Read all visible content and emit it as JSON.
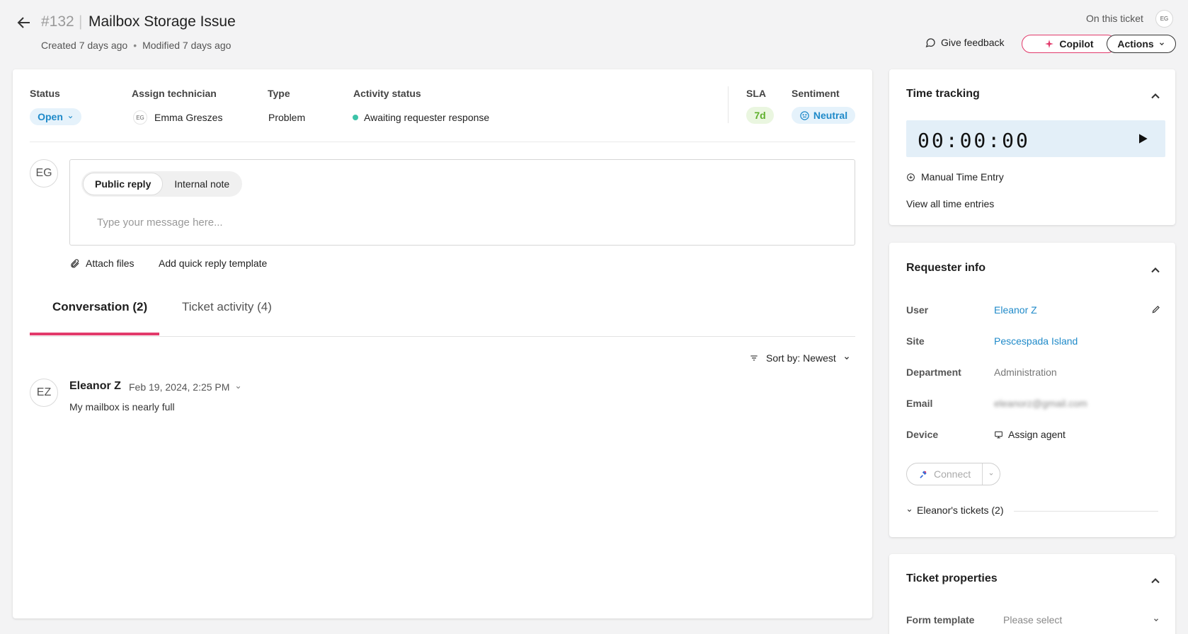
{
  "header": {
    "ticket_number": "#132",
    "separator": "|",
    "title": "Mailbox Storage Issue",
    "created": "Created 7 days ago",
    "meta_dot": "•",
    "modified": "Modified 7 days ago",
    "on_this_ticket": "On this ticket",
    "viewer_initials": "EG",
    "give_feedback": "Give feedback",
    "copilot": "Copilot",
    "actions": "Actions"
  },
  "fields": {
    "status_label": "Status",
    "status_value": "Open",
    "technician_label": "Assign technician",
    "technician_initials": "EG",
    "technician_name": "Emma Greszes",
    "type_label": "Type",
    "type_value": "Problem",
    "activity_label": "Activity status",
    "activity_value": "Awaiting requester response",
    "sla_label": "SLA",
    "sla_value": "7d",
    "sentiment_label": "Sentiment",
    "sentiment_value": "Neutral"
  },
  "composer": {
    "avatar_initials": "EG",
    "tabs": [
      "Public reply",
      "Internal note"
    ],
    "active_tab": "Public reply",
    "placeholder": "Type your message here...",
    "attach_files": "Attach files",
    "quick_reply": "Add quick reply template"
  },
  "tabs": {
    "conversation": "Conversation (2)",
    "activity": "Ticket activity (4)"
  },
  "sort": {
    "label": "Sort by:",
    "value": "Newest"
  },
  "messages": [
    {
      "initials": "EZ",
      "author": "Eleanor Z",
      "date": "Feb 19, 2024, 2:25 PM",
      "body": "My mailbox is nearly full"
    }
  ],
  "time_tracking": {
    "title": "Time tracking",
    "timer": "00:00:00",
    "manual_entry": "Manual Time Entry",
    "view_all": "View all time entries"
  },
  "requester": {
    "title": "Requester info",
    "user_label": "User",
    "user_value": "Eleanor Z",
    "site_label": "Site",
    "site_value": "Pescespada Island",
    "department_label": "Department",
    "department_value": "Administration",
    "email_label": "Email",
    "email_value": "eleanorz@gmail.com",
    "device_label": "Device",
    "device_value": "Assign agent",
    "connect": "Connect",
    "tickets": "Eleanor's tickets (2)"
  },
  "properties": {
    "title": "Ticket properties",
    "form_template_label": "Form template",
    "form_template_value": "Please select"
  },
  "colors": {
    "accent": "#e23a6b",
    "link": "#1f8ac9",
    "status_bg": "#e5f2fb",
    "sla_bg": "#eaf6e0",
    "sla_text": "#5fb02c",
    "timer_bg": "#e3eff8"
  }
}
